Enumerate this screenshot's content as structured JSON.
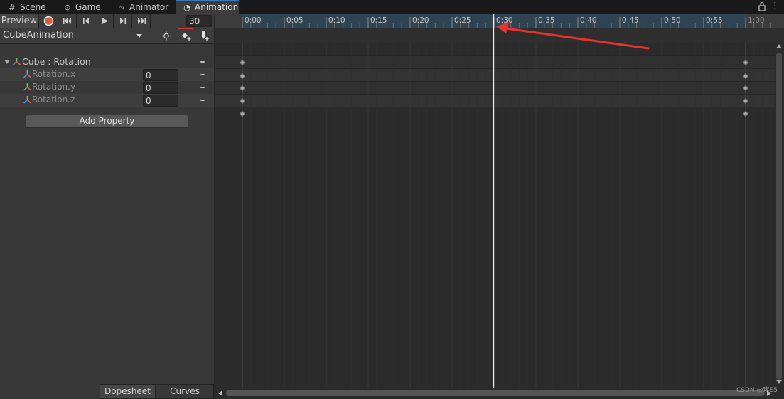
{
  "tabs": [
    {
      "label": "Scene",
      "icon": "grid-icon",
      "glyph": "#"
    },
    {
      "label": "Game",
      "icon": "gamepad-icon",
      "glyph": "⊙"
    },
    {
      "label": "Animator",
      "icon": "animator-icon",
      "glyph": "⤳"
    },
    {
      "label": "Animation",
      "icon": "clock-icon",
      "glyph": "◔"
    }
  ],
  "toolbar": {
    "preview_label": "Preview",
    "frame_value": "30",
    "clip_name": "CubeAnimation"
  },
  "properties": {
    "group_label": "Cube : Rotation",
    "items": [
      {
        "label": "Rotation.x",
        "value": "0"
      },
      {
        "label": "Rotation.y",
        "value": "0"
      },
      {
        "label": "Rotation.z",
        "value": "0"
      }
    ]
  },
  "add_property_label": "Add Property",
  "bottom_tabs": {
    "dopesheet": "Dopesheet",
    "curves": "Curves"
  },
  "timeline": {
    "ruler_labels": [
      "0:00",
      "0:05",
      "0:10",
      "0:15",
      "0:20",
      "0:25",
      "0:30",
      "0:35",
      "0:40",
      "0:45",
      "0:50",
      "0:55",
      "1:00"
    ],
    "playhead_frame": 30,
    "frames_per_label": 5,
    "keyframe_frames": [
      0,
      60
    ]
  },
  "watermark": "CSDN @琪E5",
  "colors": {
    "accent": "#3a79bb",
    "record": "#e05b3a",
    "highlight": "#d9332a",
    "arrow": "#e8322c"
  }
}
